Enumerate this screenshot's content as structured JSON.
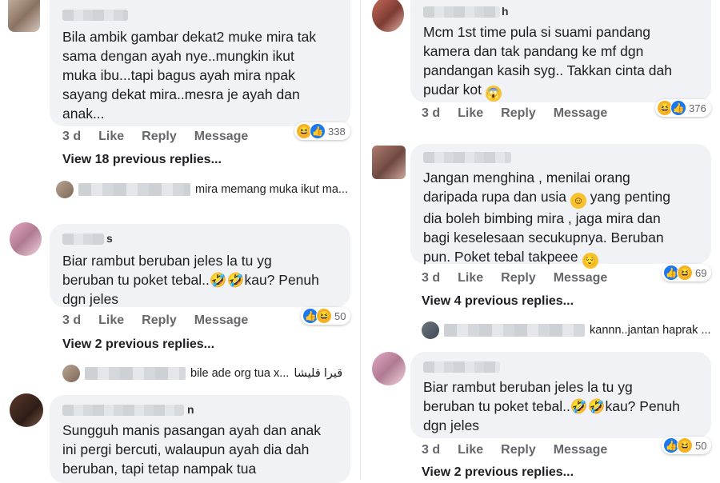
{
  "left": [
    {
      "name_tail": "",
      "text": "Bila ambik gambar dekat2 muke mira tak\nsama dengan ayah nye..mungkin ikut\nmuka ibu...tapi bagus ayah mira npak\nsayang dekat mira..mesra je ayah dan\nanak...",
      "time": "3 d",
      "like": "Like",
      "reply": "Reply",
      "message": "Message",
      "reaction_count": "338",
      "view_replies": "View 18 previous replies...",
      "reply_preview": "mira memang muka ikut ma..."
    },
    {
      "name_tail": "s",
      "text": "Biar rambut beruban jeles la tu yg\nberuban tu poket tebal..🤣🤣kau? Penuh\ndgn jeles",
      "time": "3 d",
      "like": "Like",
      "reply": "Reply",
      "message": "Message",
      "reaction_count": "50",
      "view_replies": "View 2 previous replies...",
      "reply_preview": "bile ade org tua x...",
      "reply_arabic": "قيرا قليشا"
    },
    {
      "name_tail": "n",
      "text": "Sungguh manis pasangan ayah dan anak\nini pergi bercuti, walaupun ayah dia dah\nberuban, tapi tetap nampak tua"
    }
  ],
  "right": [
    {
      "name_tail": "h",
      "text": "Mcm 1st time pula si suami pandang\nkamera dan tak pandang ke mf dgn\npandangan kasih syg.. Takkan cinta dah\npudar kot",
      "time": "3 d",
      "like": "Like",
      "reply": "Reply",
      "message": "Message",
      "reaction_count": "376"
    },
    {
      "name_tail": "",
      "text_lines": [
        "Jangan menghina , menilai orang",
        "daripada rupa dan usia",
        "yang penting",
        "dia boleh bimbing mira , jaga mira dan",
        "bagi keselesaan secukupnya.  Beruban",
        "pun. Poket tebal takpeee"
      ],
      "time": "3 d",
      "like": "Like",
      "reply": "Reply",
      "message": "Message",
      "reaction_count": "69",
      "view_replies": "View 4 previous replies...",
      "reply_preview": "kannn..jantan haprak ..."
    },
    {
      "name_tail": "",
      "text": "Biar rambut beruban jeles la tu yg\nberuban tu poket tebal..🤣🤣kau? Penuh\ndgn jeles",
      "time": "3 d",
      "like": "Like",
      "reply": "Reply",
      "message": "Message",
      "reaction_count": "50",
      "view_replies": "View 2 previous replies..."
    }
  ],
  "icons": {
    "haha": "😆",
    "like": "👍",
    "smile": "☺",
    "relieved": "😌",
    "shock": "😱"
  }
}
